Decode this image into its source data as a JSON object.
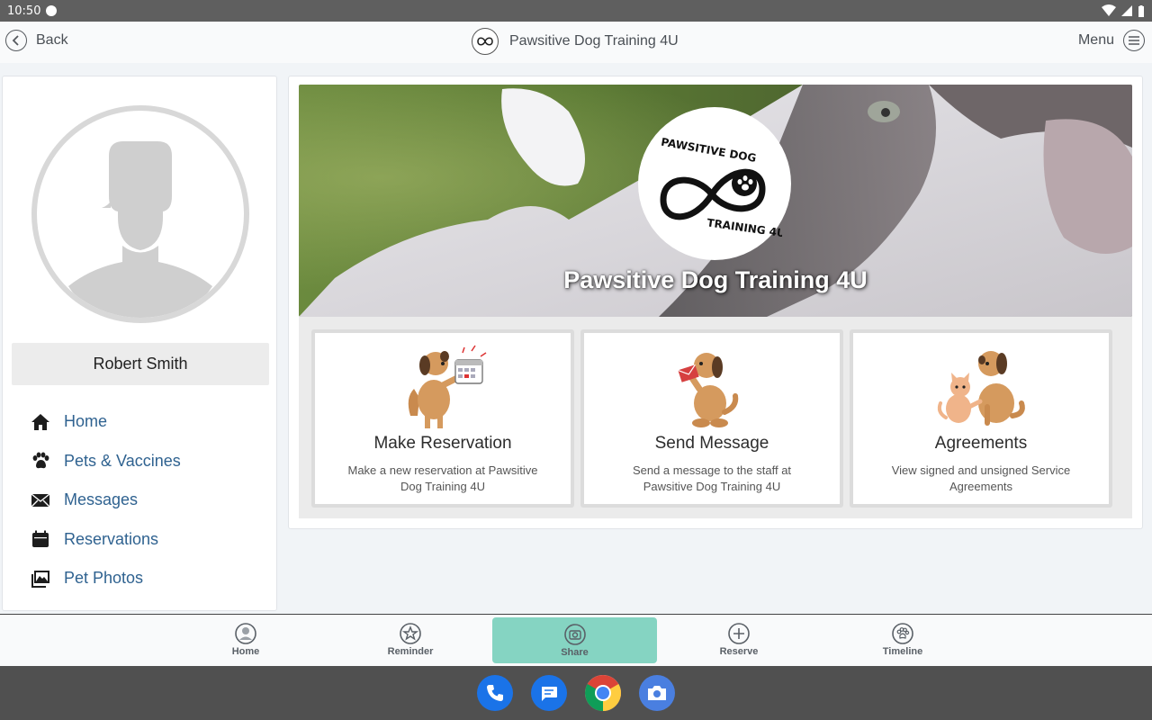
{
  "status_bar": {
    "time": "10:50"
  },
  "header": {
    "back_label": "Back",
    "title": "Pawsitive Dog Training 4U",
    "menu_label": "Menu"
  },
  "sidebar": {
    "user_name": "Robert Smith",
    "items": [
      {
        "label": "Home",
        "icon": "house-icon"
      },
      {
        "label": "Pets & Vaccines",
        "icon": "paw-icon"
      },
      {
        "label": "Messages",
        "icon": "envelope-icon"
      },
      {
        "label": "Reservations",
        "icon": "calendar-icon"
      },
      {
        "label": "Pet Photos",
        "icon": "photos-icon"
      }
    ]
  },
  "hero": {
    "title": "Pawsitive Dog Training 4U",
    "logo_line1": "PAWSITIVE DOG",
    "logo_line2": "TRAINING 4U"
  },
  "cards": [
    {
      "title": "Make Reservation",
      "desc": "Make a new reservation at Pawsitive Dog Training 4U",
      "icon": "dog-calendar-illustration"
    },
    {
      "title": "Send Message",
      "desc": "Send a message to the staff at Pawsitive Dog Training 4U",
      "icon": "dog-letter-illustration"
    },
    {
      "title": "Agreements",
      "desc": "View signed and unsigned Service Agreements",
      "icon": "dog-cat-illustration"
    }
  ],
  "bottom_nav": [
    {
      "label": "Home",
      "icon": "user-icon"
    },
    {
      "label": "Reminder",
      "icon": "star-icon"
    },
    {
      "label": "Share",
      "icon": "camera-icon",
      "active": true
    },
    {
      "label": "Reserve",
      "icon": "plus-icon"
    },
    {
      "label": "Timeline",
      "icon": "paw-icon"
    }
  ],
  "colors": {
    "link": "#2f6290",
    "share_active": "#85d4c2",
    "status_bar": "#5f5f5f",
    "dock": "#505050"
  }
}
